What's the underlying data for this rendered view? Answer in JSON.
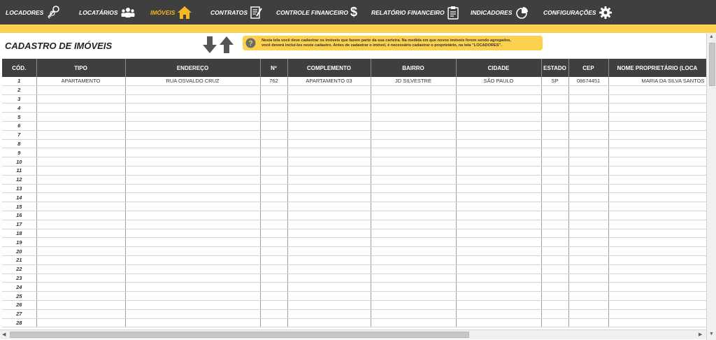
{
  "nav": {
    "items": [
      {
        "label": "LOCADORES",
        "icon": "keys-icon"
      },
      {
        "label": "LOCATÁRIOS",
        "icon": "people-icon"
      },
      {
        "label": "IMÓVEIS",
        "icon": "house-icon"
      },
      {
        "label": "CONTRATOS",
        "icon": "contract-icon"
      },
      {
        "label": "CONTROLE FINANCEIRO",
        "icon": "dollar-icon"
      },
      {
        "label": "RELATÓRIO FINANCEIRO",
        "icon": "report-icon"
      },
      {
        "label": "INDICADORES",
        "icon": "pie-chart-icon"
      },
      {
        "label": "CONFIGURAÇÕES",
        "icon": "gear-icon"
      }
    ],
    "active": "IMÓVEIS"
  },
  "page": {
    "title": "CADASTRO DE IMÓVEIS",
    "info_line1": "Nesta tela você deve cadastrar os imóveis que fazem parte da sua carteira. Na medida em que novos imóveis forem sendo agregados,",
    "info_line2": "você deverá incluí-los neste cadastro. Antes de cadastrar o imóvel, é necessário cadastrar o proprietário, na tela \"LOCADORES\"."
  },
  "table": {
    "columns": [
      "CÓD.",
      "TIPO",
      "ENDEREÇO",
      "Nº",
      "COMPLEMENTO",
      "BAIRRO",
      "CIDADE",
      "ESTADO",
      "CEP",
      "NOME PROPRIETÁRIO (LOCA"
    ],
    "rows": [
      [
        "1",
        "APARTAMENTO",
        "RUA OSVALDO CRUZ",
        "762",
        "APARTAMENTO 03",
        "JD SILVESTRE",
        "SÃO PAULO",
        "SP",
        "08674451",
        "MARIA DA SILVA SANTOS"
      ],
      [
        "2",
        "",
        "",
        "",
        "",
        "",
        "",
        "",
        "",
        ""
      ],
      [
        "3",
        "",
        "",
        "",
        "",
        "",
        "",
        "",
        "",
        ""
      ],
      [
        "4",
        "",
        "",
        "",
        "",
        "",
        "",
        "",
        "",
        ""
      ],
      [
        "5",
        "",
        "",
        "",
        "",
        "",
        "",
        "",
        "",
        ""
      ],
      [
        "6",
        "",
        "",
        "",
        "",
        "",
        "",
        "",
        "",
        ""
      ],
      [
        "7",
        "",
        "",
        "",
        "",
        "",
        "",
        "",
        "",
        ""
      ],
      [
        "8",
        "",
        "",
        "",
        "",
        "",
        "",
        "",
        "",
        ""
      ],
      [
        "9",
        "",
        "",
        "",
        "",
        "",
        "",
        "",
        "",
        ""
      ],
      [
        "10",
        "",
        "",
        "",
        "",
        "",
        "",
        "",
        "",
        ""
      ],
      [
        "11",
        "",
        "",
        "",
        "",
        "",
        "",
        "",
        "",
        ""
      ],
      [
        "12",
        "",
        "",
        "",
        "",
        "",
        "",
        "",
        "",
        ""
      ],
      [
        "13",
        "",
        "",
        "",
        "",
        "",
        "",
        "",
        "",
        ""
      ],
      [
        "14",
        "",
        "",
        "",
        "",
        "",
        "",
        "",
        "",
        ""
      ],
      [
        "15",
        "",
        "",
        "",
        "",
        "",
        "",
        "",
        "",
        ""
      ],
      [
        "16",
        "",
        "",
        "",
        "",
        "",
        "",
        "",
        "",
        ""
      ],
      [
        "17",
        "",
        "",
        "",
        "",
        "",
        "",
        "",
        "",
        ""
      ],
      [
        "18",
        "",
        "",
        "",
        "",
        "",
        "",
        "",
        "",
        ""
      ],
      [
        "19",
        "",
        "",
        "",
        "",
        "",
        "",
        "",
        "",
        ""
      ],
      [
        "20",
        "",
        "",
        "",
        "",
        "",
        "",
        "",
        "",
        ""
      ],
      [
        "21",
        "",
        "",
        "",
        "",
        "",
        "",
        "",
        "",
        ""
      ],
      [
        "22",
        "",
        "",
        "",
        "",
        "",
        "",
        "",
        "",
        ""
      ],
      [
        "23",
        "",
        "",
        "",
        "",
        "",
        "",
        "",
        "",
        ""
      ],
      [
        "24",
        "",
        "",
        "",
        "",
        "",
        "",
        "",
        "",
        ""
      ],
      [
        "25",
        "",
        "",
        "",
        "",
        "",
        "",
        "",
        "",
        ""
      ],
      [
        "26",
        "",
        "",
        "",
        "",
        "",
        "",
        "",
        "",
        ""
      ],
      [
        "27",
        "",
        "",
        "",
        "",
        "",
        "",
        "",
        "",
        ""
      ],
      [
        "28",
        "",
        "",
        "",
        "",
        "",
        "",
        "",
        "",
        ""
      ]
    ]
  },
  "colors": {
    "topbar": "#3f3f3f",
    "accent": "#fdd14d",
    "active_nav": "#f2b81e"
  }
}
